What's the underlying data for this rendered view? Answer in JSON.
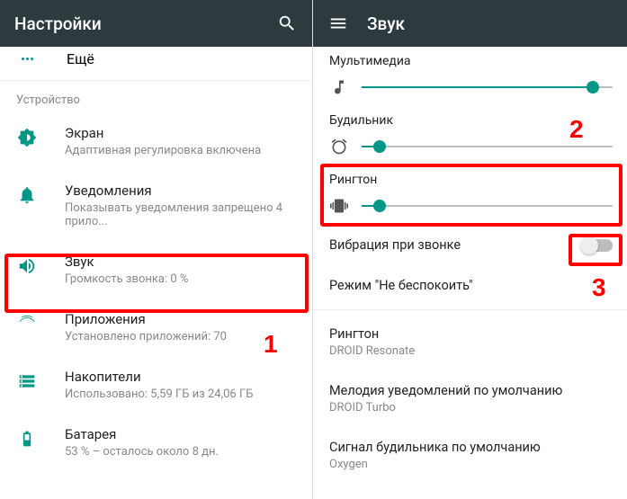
{
  "left": {
    "title": "Настройки",
    "more": "Ещё",
    "section": "Устройство",
    "items": [
      {
        "title": "Экран",
        "sub": "Адаптивная регулировка включена"
      },
      {
        "title": "Уведомления",
        "sub": "Показывать уведомления запрещено 4 прило..."
      },
      {
        "title": "Звук",
        "sub": "Громкость звонка: 0 %"
      },
      {
        "title": "Приложения",
        "sub": "Установлено приложений: 70"
      },
      {
        "title": "Накопители",
        "sub": "Использовано: 5,59 ГБ из 24,06 ГБ"
      },
      {
        "title": "Батарея",
        "sub": "53 % – осталось около 8 дн."
      }
    ]
  },
  "right": {
    "title": "Звук",
    "sliders": [
      {
        "label": "Мультимедиа",
        "pct": 92
      },
      {
        "label": "Будильник",
        "pct": 7
      },
      {
        "label": "Рингтон",
        "pct": 7
      }
    ],
    "settings": [
      {
        "title": "Вибрация при звонке",
        "switch": true
      },
      {
        "title": "Режим \"Не беспокоить\""
      },
      {
        "title": "Рингтон",
        "sub": "DROID Resonate"
      },
      {
        "title": "Мелодия уведомлений по умолчанию",
        "sub": "DROID Turbo"
      },
      {
        "title": "Сигнал будильника по умолчанию",
        "sub": "Oxygen"
      }
    ]
  },
  "annotations": {
    "a1": "1",
    "a2": "2",
    "a3": "3"
  }
}
